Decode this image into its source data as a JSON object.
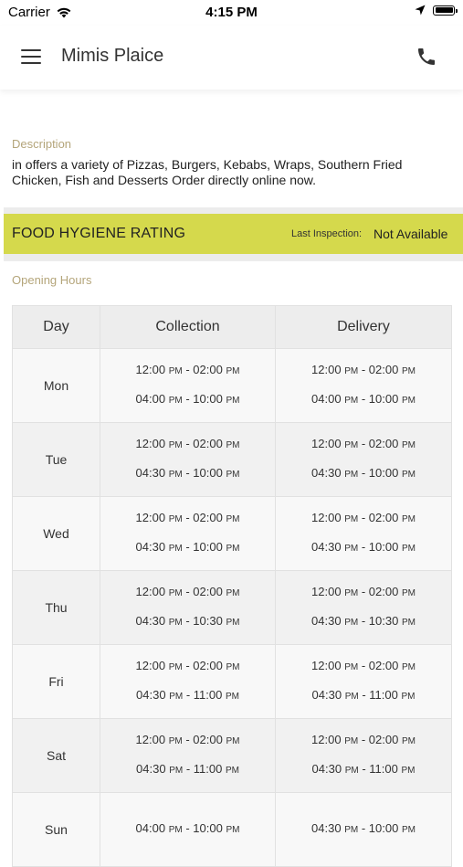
{
  "status_bar": {
    "carrier": "Carrier",
    "time": "4:15 PM"
  },
  "header": {
    "title": "Mimis Plaice"
  },
  "description": {
    "label": "Description",
    "text": "in  offers a variety of Pizzas, Burgers, Kebabs, Wraps, Southern Fried Chicken, Fish and Desserts Order directly online now."
  },
  "hygiene": {
    "title": "FOOD HYGIENE RATING",
    "last_inspection_label": "Last Inspection:",
    "last_inspection_value": "Not Available",
    "band_color": "#d5d94c"
  },
  "opening_hours": {
    "label": "Opening Hours",
    "columns": [
      "Day",
      "Collection",
      "Delivery"
    ],
    "rows": [
      {
        "day": "Mon",
        "collection": [
          {
            "from_t": "12:00",
            "from_p": "PM",
            "to_t": "02:00",
            "to_p": "PM"
          },
          {
            "from_t": "04:00",
            "from_p": "PM",
            "to_t": "10:00",
            "to_p": "PM"
          }
        ],
        "delivery": [
          {
            "from_t": "12:00",
            "from_p": "PM",
            "to_t": "02:00",
            "to_p": "PM"
          },
          {
            "from_t": "04:00",
            "from_p": "PM",
            "to_t": "10:00",
            "to_p": "PM"
          }
        ]
      },
      {
        "day": "Tue",
        "collection": [
          {
            "from_t": "12:00",
            "from_p": "PM",
            "to_t": "02:00",
            "to_p": "PM"
          },
          {
            "from_t": "04:30",
            "from_p": "PM",
            "to_t": "10:00",
            "to_p": "PM"
          }
        ],
        "delivery": [
          {
            "from_t": "12:00",
            "from_p": "PM",
            "to_t": "02:00",
            "to_p": "PM"
          },
          {
            "from_t": "04:30",
            "from_p": "PM",
            "to_t": "10:00",
            "to_p": "PM"
          }
        ]
      },
      {
        "day": "Wed",
        "collection": [
          {
            "from_t": "12:00",
            "from_p": "PM",
            "to_t": "02:00",
            "to_p": "PM"
          },
          {
            "from_t": "04:30",
            "from_p": "PM",
            "to_t": "10:00",
            "to_p": "PM"
          }
        ],
        "delivery": [
          {
            "from_t": "12:00",
            "from_p": "PM",
            "to_t": "02:00",
            "to_p": "PM"
          },
          {
            "from_t": "04:30",
            "from_p": "PM",
            "to_t": "10:00",
            "to_p": "PM"
          }
        ]
      },
      {
        "day": "Thu",
        "collection": [
          {
            "from_t": "12:00",
            "from_p": "PM",
            "to_t": "02:00",
            "to_p": "PM"
          },
          {
            "from_t": "04:30",
            "from_p": "PM",
            "to_t": "10:30",
            "to_p": "PM"
          }
        ],
        "delivery": [
          {
            "from_t": "12:00",
            "from_p": "PM",
            "to_t": "02:00",
            "to_p": "PM"
          },
          {
            "from_t": "04:30",
            "from_p": "PM",
            "to_t": "10:30",
            "to_p": "PM"
          }
        ]
      },
      {
        "day": "Fri",
        "collection": [
          {
            "from_t": "12:00",
            "from_p": "PM",
            "to_t": "02:00",
            "to_p": "PM"
          },
          {
            "from_t": "04:30",
            "from_p": "PM",
            "to_t": "11:00",
            "to_p": "PM"
          }
        ],
        "delivery": [
          {
            "from_t": "12:00",
            "from_p": "PM",
            "to_t": "02:00",
            "to_p": "PM"
          },
          {
            "from_t": "04:30",
            "from_p": "PM",
            "to_t": "11:00",
            "to_p": "PM"
          }
        ]
      },
      {
        "day": "Sat",
        "collection": [
          {
            "from_t": "12:00",
            "from_p": "PM",
            "to_t": "02:00",
            "to_p": "PM"
          },
          {
            "from_t": "04:30",
            "from_p": "PM",
            "to_t": "11:00",
            "to_p": "PM"
          }
        ],
        "delivery": [
          {
            "from_t": "12:00",
            "from_p": "PM",
            "to_t": "02:00",
            "to_p": "PM"
          },
          {
            "from_t": "04:30",
            "from_p": "PM",
            "to_t": "11:00",
            "to_p": "PM"
          }
        ]
      },
      {
        "day": "Sun",
        "collection": [
          {
            "from_t": "04:00",
            "from_p": "PM",
            "to_t": "10:00",
            "to_p": "PM"
          }
        ],
        "delivery": [
          {
            "from_t": "04:30",
            "from_p": "PM",
            "to_t": "10:00",
            "to_p": "PM"
          }
        ]
      }
    ]
  },
  "icons": {
    "menu": "hamburger-menu-icon",
    "phone": "phone-icon",
    "wifi": "wifi-icon",
    "location": "location-arrow-icon",
    "battery": "battery-icon"
  }
}
